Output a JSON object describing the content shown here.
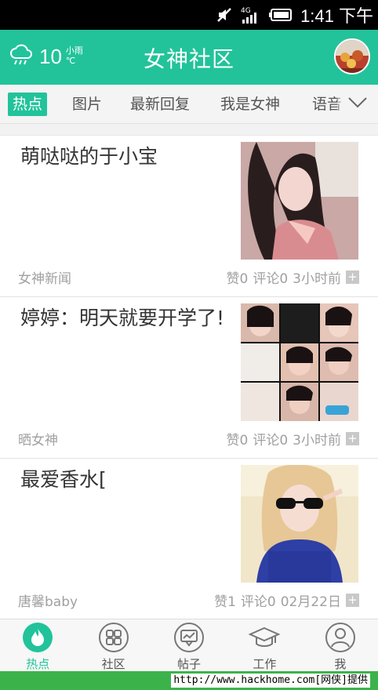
{
  "status_bar": {
    "network": "4G",
    "time": "1:41 下午"
  },
  "header": {
    "temperature": "10",
    "weather_desc": "小雨",
    "unit": "℃",
    "title": "女神社区"
  },
  "tabs": [
    {
      "label": "热点",
      "active": true
    },
    {
      "label": "图片"
    },
    {
      "label": "最新回复"
    },
    {
      "label": "我是女神"
    },
    {
      "label": "语音"
    }
  ],
  "posts": [
    {
      "title": "萌哒哒的于小宝",
      "source": "女神新闻",
      "likes": "赞0",
      "comments": "评论0",
      "time": "3小时前"
    },
    {
      "title": "婷婷：明天就要开学了!",
      "source": "晒女神",
      "likes": "赞0",
      "comments": "评论0",
      "time": "3小时前"
    },
    {
      "title": "最爱香水[",
      "source": "唐馨baby",
      "likes": "赞1",
      "comments": "评论0",
      "time": "02月22日"
    }
  ],
  "bottom_nav": [
    {
      "label": "热点",
      "icon": "flame-icon",
      "active": true
    },
    {
      "label": "社区",
      "icon": "grid-icon"
    },
    {
      "label": "帖子",
      "icon": "chat-chart-icon"
    },
    {
      "label": "工作",
      "icon": "graduation-cap-icon"
    },
    {
      "label": "我",
      "icon": "person-icon"
    }
  ],
  "watermark": "http://www.hackhome.com[网侠]提供",
  "colors": {
    "accent": "#22c39a",
    "watermark_bar": "#3cb34a"
  }
}
